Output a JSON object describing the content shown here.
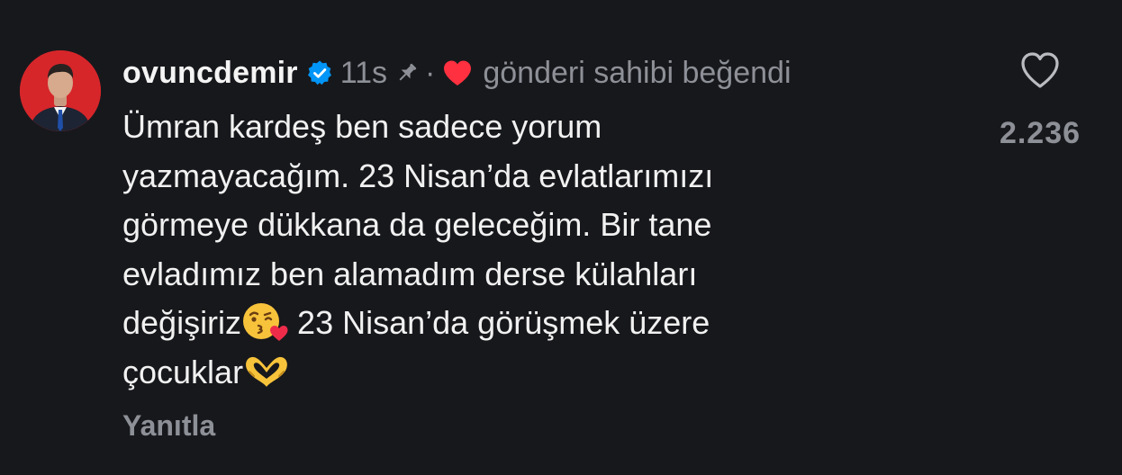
{
  "comment": {
    "username": "ovuncdemir",
    "time": "11s",
    "separator": "·",
    "liked_by_author_text": "gönderi sahibi beğendi",
    "lines": [
      "Ümran kardeş ben sadece yorum",
      "yazmayacağım. 23 Nisan’da evlatlarımızı",
      "görmeye dükkana da geleceğim. Bir tane",
      "evladımız ben alamadım derse külahları",
      "değişiriz",
      " 23 Nisan’da görüşmek üzere",
      "çocuklar"
    ],
    "reply_label": "Yanıtla",
    "like_count": "2.236"
  },
  "icons": {
    "verified": "verified-badge-icon",
    "pin": "pin-icon",
    "author_like": "heart-filled-icon",
    "like_button": "heart-outline-icon",
    "emoji_1": "kissing-face-emoji",
    "emoji_2": "heart-hands-emoji"
  },
  "colors": {
    "background": "#17181c",
    "verified_blue": "#0095f6",
    "heart_red": "#ff3040",
    "muted_text": "#8e9097"
  }
}
